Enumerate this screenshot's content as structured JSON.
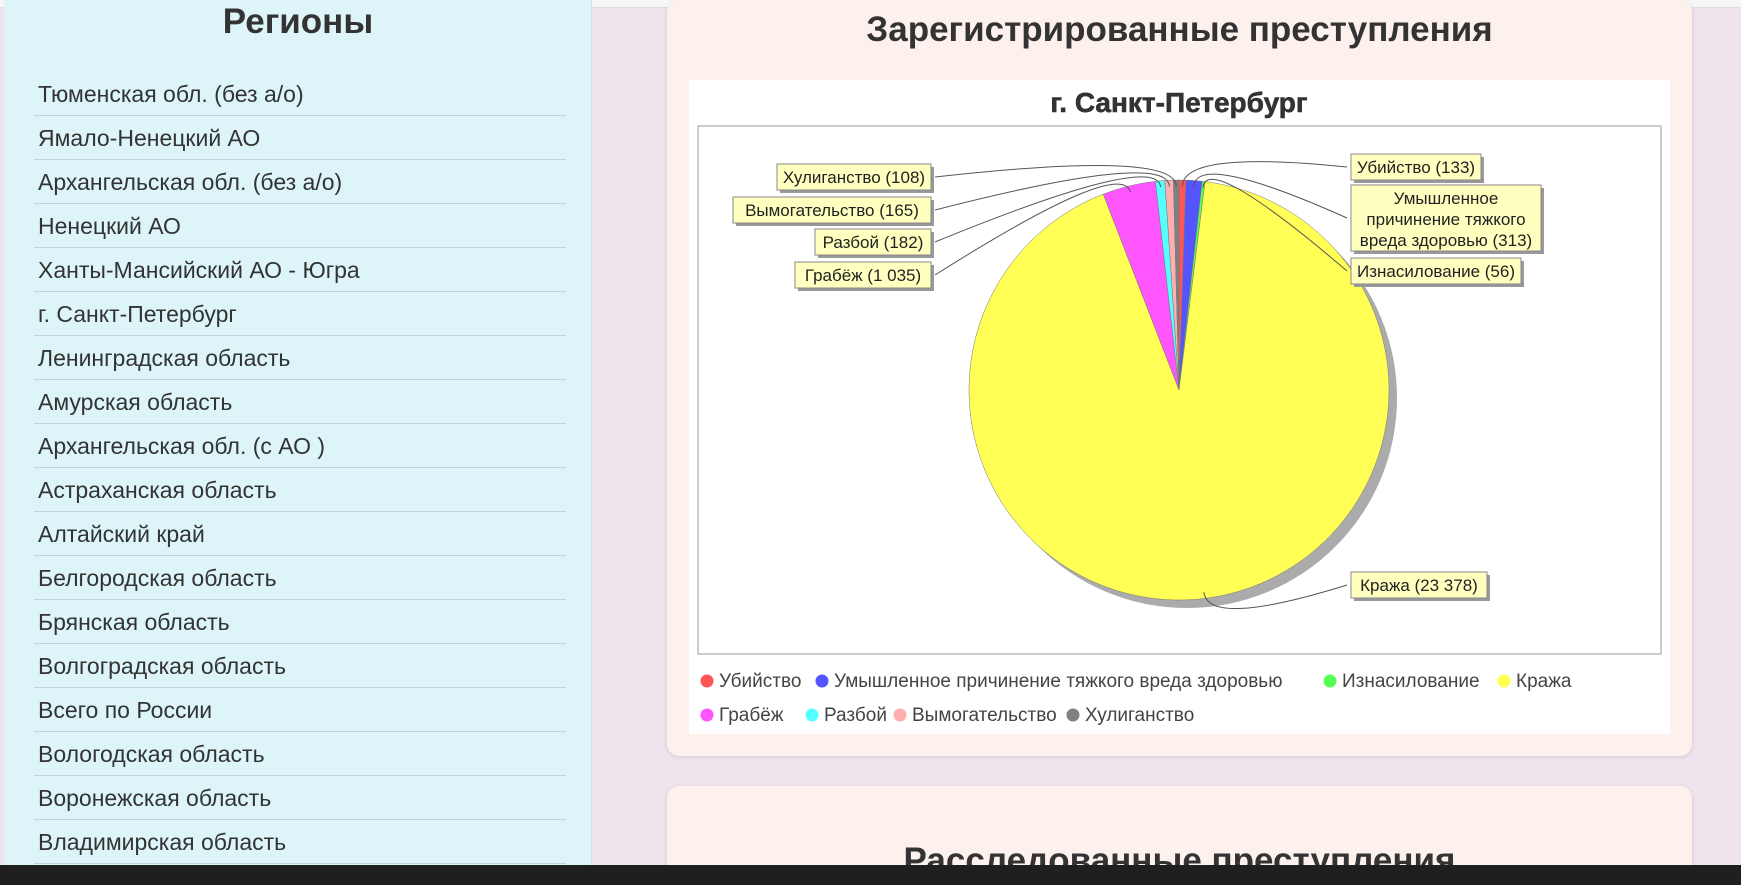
{
  "sidebar": {
    "title": "Регионы",
    "regions": [
      "Тюменская обл. (без а/о)",
      "Ямало-Ненецкий АО",
      "Архангельская обл. (без а/о)",
      "Ненецкий АО",
      "Ханты-Мансийский АО - Югра",
      "г. Санкт-Петербург",
      "Ленинградская область",
      "Амурская область",
      "Архангельская обл. (с АО )",
      "Астраханская область",
      "Алтайский край",
      "Белгородская область",
      "Брянская область",
      "Волгоградская область",
      "Всего по России",
      "Вологодская область",
      "Воронежская область",
      "Владимирская область"
    ]
  },
  "main": {
    "card_title": "Зарегистрированные преступления",
    "next_card_title": "Расследованные преступления"
  },
  "chart_data": {
    "type": "pie",
    "title": "г. Санкт-Петербург",
    "series": [
      {
        "name": "Убийство",
        "value": 133,
        "label": "Убийство (133)",
        "color": "#ff5555"
      },
      {
        "name": "Умышленное причинение тяжкого вреда здоровью",
        "value": 313,
        "label": "Умышленное причинение тяжкого вреда здоровью (313)",
        "color": "#5555ff"
      },
      {
        "name": "Изнасилование",
        "value": 56,
        "label": "Изнасилование (56)",
        "color": "#55ff55"
      },
      {
        "name": "Кража",
        "value": 23378,
        "label": "Кража (23 378)",
        "color": "#ffff55"
      },
      {
        "name": "Грабёж",
        "value": 1035,
        "label": "Грабёж (1 035)",
        "color": "#ff55ff"
      },
      {
        "name": "Разбой",
        "value": 182,
        "label": "Разбой (182)",
        "color": "#55ffff"
      },
      {
        "name": "Вымогательство",
        "value": 165,
        "label": "Вымогательство (165)",
        "color": "#ffafaf"
      },
      {
        "name": "Хулиганство",
        "value": 108,
        "label": "Хулиганство (108)",
        "color": "#808080"
      }
    ],
    "legend_position": "bottom",
    "label_bg": "#ffffc0"
  }
}
